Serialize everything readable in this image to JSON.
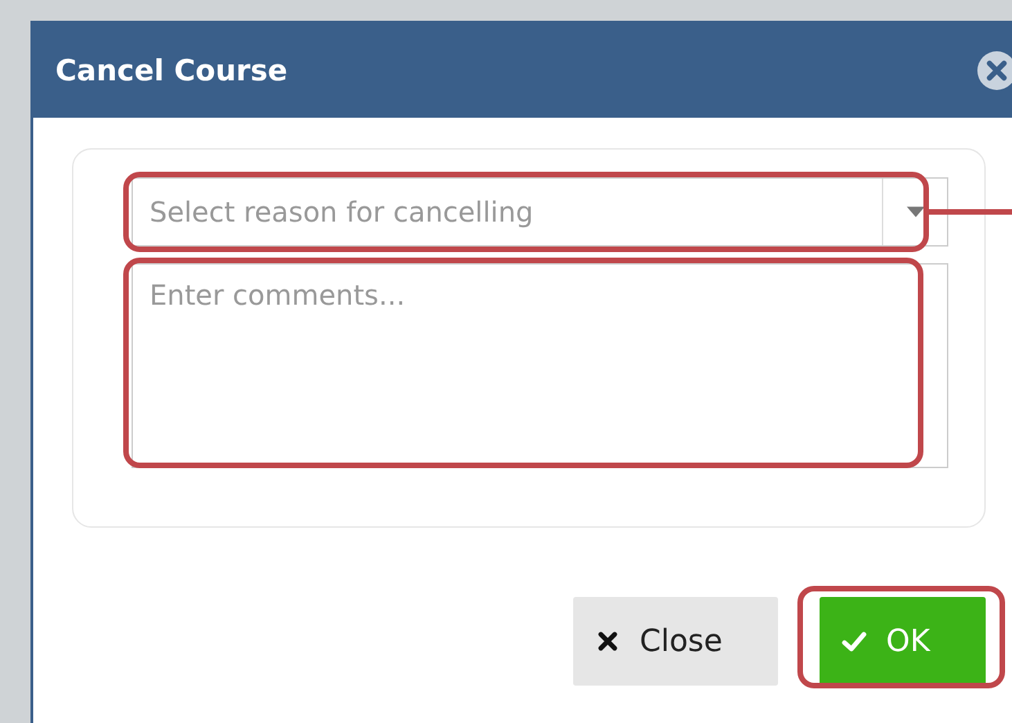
{
  "dialog": {
    "title": "Cancel Course"
  },
  "reason_select": {
    "placeholder": "Select reason for cancelling",
    "highlighted": true
  },
  "comments": {
    "placeholder": "Enter comments...",
    "highlighted": true
  },
  "buttons": [
    {
      "label": "Close",
      "kind": "close",
      "highlighted": false
    },
    {
      "label": "OK",
      "kind": "ok",
      "highlighted": true
    }
  ]
}
